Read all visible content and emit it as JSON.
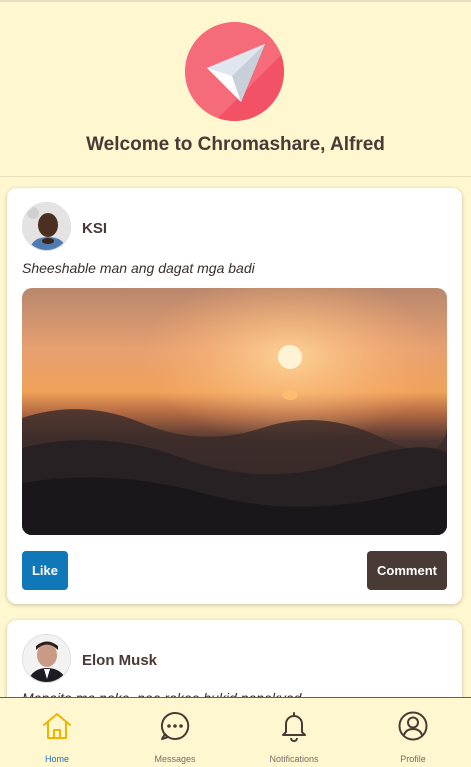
{
  "header": {
    "welcome": "Welcome to Chromashare, Alfred"
  },
  "posts": [
    {
      "author": "KSI",
      "caption": "Sheeshable man ang dagat mga badi",
      "like_label": "Like",
      "comment_label": "Comment"
    },
    {
      "author": "Elon Musk",
      "caption": "Mapaite ma naka, nea rakae bukid panakyad"
    }
  ],
  "bottom_nav": {
    "items": [
      {
        "label": "Home",
        "icon": "home-icon",
        "active": true
      },
      {
        "label": "Messages",
        "icon": "chat-icon",
        "active": false
      },
      {
        "label": "Notifications",
        "icon": "bell-icon",
        "active": false
      },
      {
        "label": "Profile",
        "icon": "user-circle-icon",
        "active": false
      }
    ]
  },
  "colors": {
    "background": "#fff7cf",
    "logo": "#f56b7a",
    "like_button": "#1077b8",
    "comment_button": "#4a3a36",
    "text": "#4a3a36",
    "active_nav": "#f0b400"
  }
}
